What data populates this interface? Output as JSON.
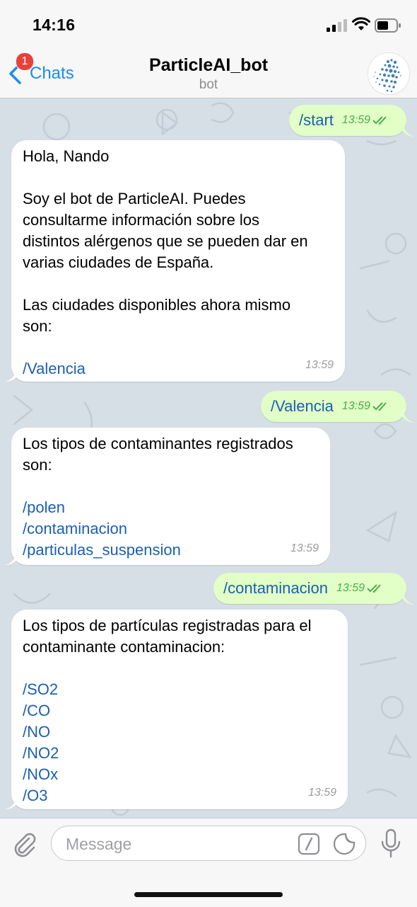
{
  "status_bar": {
    "time": "14:16"
  },
  "nav": {
    "back_label": "Chats",
    "unread_badge": "1",
    "title": "ParticleAI_bot",
    "subtitle": "bot"
  },
  "messages": [
    {
      "dir": "out",
      "text": "/start",
      "time": "13:59"
    },
    {
      "dir": "in",
      "time": "13:59",
      "lines": [
        "Hola, Nando",
        "",
        "Soy el bot de ParticleAI. Puedes",
        "consultarme información sobre los",
        "distintos alérgenos que se pueden dar en",
        "varias ciudades de España.",
        "",
        "Las ciudades disponibles ahora mismo",
        "son:",
        "",
        "/Valencia"
      ]
    },
    {
      "dir": "out",
      "text": "/Valencia",
      "time": "13:59"
    },
    {
      "dir": "in",
      "time": "13:59",
      "lines": [
        "Los tipos de contaminantes registrados",
        "son:",
        "",
        "/polen",
        "/contaminacion",
        "/particulas_suspension"
      ]
    },
    {
      "dir": "out",
      "text": "/contaminacion",
      "time": "13:59"
    },
    {
      "dir": "in",
      "time": "13:59",
      "lines": [
        "Los tipos de partículas registradas para el",
        "contaminante contaminacion:",
        "",
        "/SO2",
        "/CO",
        "/NO",
        "/NO2",
        "/NOx",
        "/O3"
      ]
    }
  ],
  "input": {
    "placeholder": "Message"
  },
  "icons": {
    "back": "chevron-left-icon",
    "attach": "paperclip-icon",
    "commands": "slash-command-icon",
    "sticker": "sticker-icon",
    "mic": "microphone-icon",
    "read": "double-check-icon"
  },
  "colors": {
    "accent": "#1a8cf0",
    "outgoing_bubble": "#e1ffc7",
    "incoming_bubble": "#ffffff",
    "link": "#1b5fb0",
    "badge": "#e8403a"
  }
}
